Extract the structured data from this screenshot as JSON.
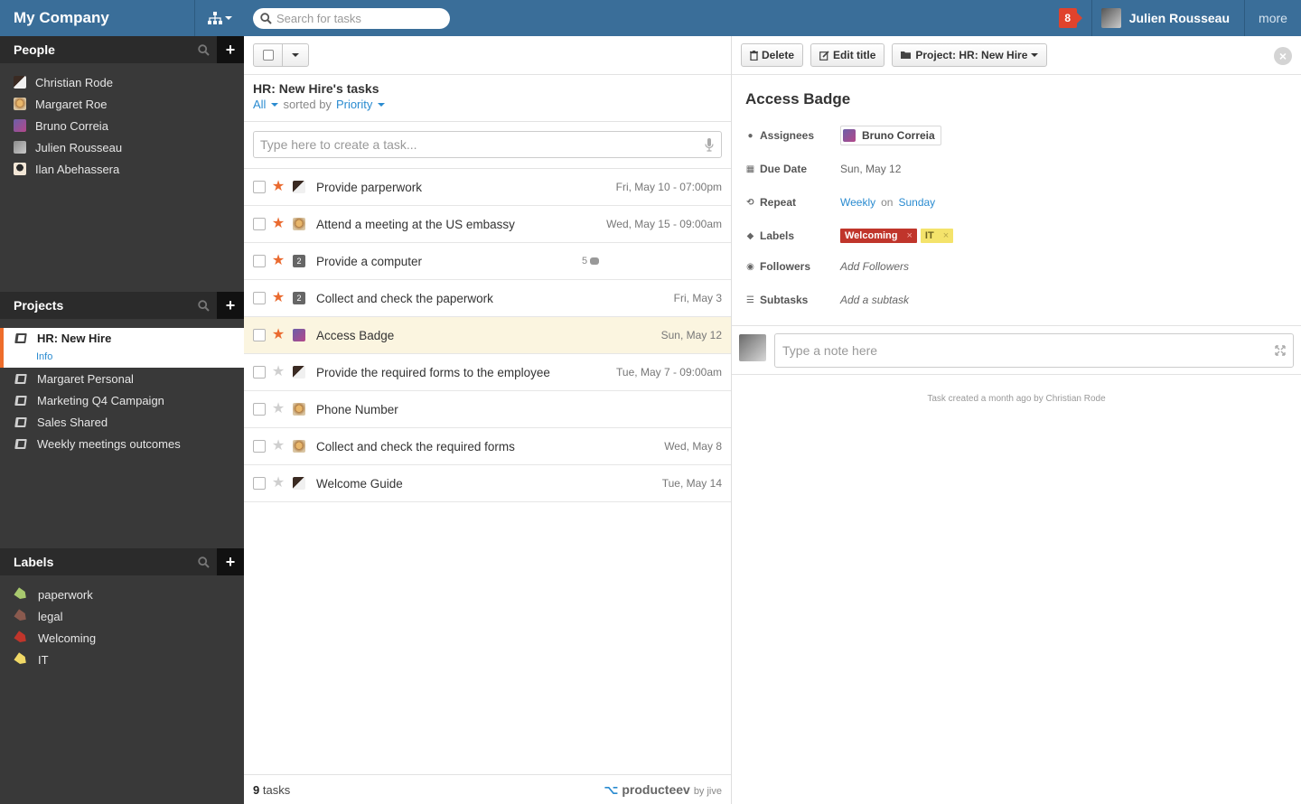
{
  "topbar": {
    "brand": "My Company",
    "search_placeholder": "Search for tasks",
    "notification_count": "8",
    "user_name": "Julien Rousseau",
    "more_label": "more"
  },
  "sidebar": {
    "people": {
      "title": "People",
      "items": [
        {
          "name": "Christian Rode"
        },
        {
          "name": "Margaret Roe"
        },
        {
          "name": "Bruno Correia"
        },
        {
          "name": "Julien Rousseau"
        },
        {
          "name": "Ilan Abehassera"
        }
      ]
    },
    "projects": {
      "title": "Projects",
      "active": {
        "name": "HR: New Hire",
        "sub": "Info"
      },
      "items": [
        {
          "name": "Margaret Personal"
        },
        {
          "name": "Marketing Q4 Campaign"
        },
        {
          "name": "Sales Shared"
        },
        {
          "name": "Weekly meetings outcomes"
        }
      ]
    },
    "labels": {
      "title": "Labels",
      "items": [
        {
          "name": "paperwork",
          "color": "#a8c96e"
        },
        {
          "name": "legal",
          "color": "#8a5a4e"
        },
        {
          "name": "Welcoming",
          "color": "#c0352b"
        },
        {
          "name": "IT",
          "color": "#f0d866"
        }
      ]
    }
  },
  "list": {
    "title": "HR: New Hire's tasks",
    "filter_label": "All",
    "sorted_by_label": "sorted by",
    "sort_label": "Priority",
    "create_placeholder": "Type here to create a task...",
    "tasks": [
      {
        "name": "Provide parperwork",
        "due": "Fri, May 10 - 07:00pm",
        "starred": true
      },
      {
        "name": "Attend a meeting at the US embassy",
        "due": "Wed, May 15 - 09:00am",
        "starred": true
      },
      {
        "name": "Provide a computer",
        "due": "",
        "starred": true,
        "assignee_count": "2",
        "comments": "5"
      },
      {
        "name": "Collect and check the paperwork",
        "due": "Fri, May 3",
        "starred": true,
        "assignee_count": "2"
      },
      {
        "name": "Access Badge",
        "due": "Sun, May 12",
        "starred": true,
        "selected": true
      },
      {
        "name": "Provide the required forms to the employee",
        "due": "Tue, May 7 - 09:00am",
        "starred": false
      },
      {
        "name": "Phone Number",
        "due": "",
        "starred": false
      },
      {
        "name": "Collect and check the required forms",
        "due": "Wed, May 8",
        "starred": false
      },
      {
        "name": "Welcome Guide",
        "due": "Tue, May 14",
        "starred": false
      }
    ],
    "footer": {
      "count": "9",
      "count_label": "tasks",
      "brand": "producteev",
      "brand_by": "by jive"
    }
  },
  "detail": {
    "toolbar": {
      "delete": "Delete",
      "edit_title": "Edit title",
      "project": "Project: HR: New Hire"
    },
    "title": "Access Badge",
    "props": {
      "assignees_label": "Assignees",
      "assignee": "Bruno Correia",
      "due_label": "Due Date",
      "due": "Sun, May 12",
      "repeat_label": "Repeat",
      "repeat_freq": "Weekly",
      "repeat_on": "on",
      "repeat_day": "Sunday",
      "labels_label": "Labels",
      "label_1": "Welcoming",
      "label_2": "IT",
      "followers_label": "Followers",
      "followers_placeholder": "Add Followers",
      "subtasks_label": "Subtasks",
      "subtasks_placeholder": "Add a subtask"
    },
    "note_placeholder": "Type a note here",
    "created": "Task created a month ago by Christian Rode"
  },
  "colors": {
    "accent": "#3a6e99",
    "star": "#ea6a2f",
    "link": "#2a8bd0",
    "active_bar": "#ee6d2b"
  }
}
